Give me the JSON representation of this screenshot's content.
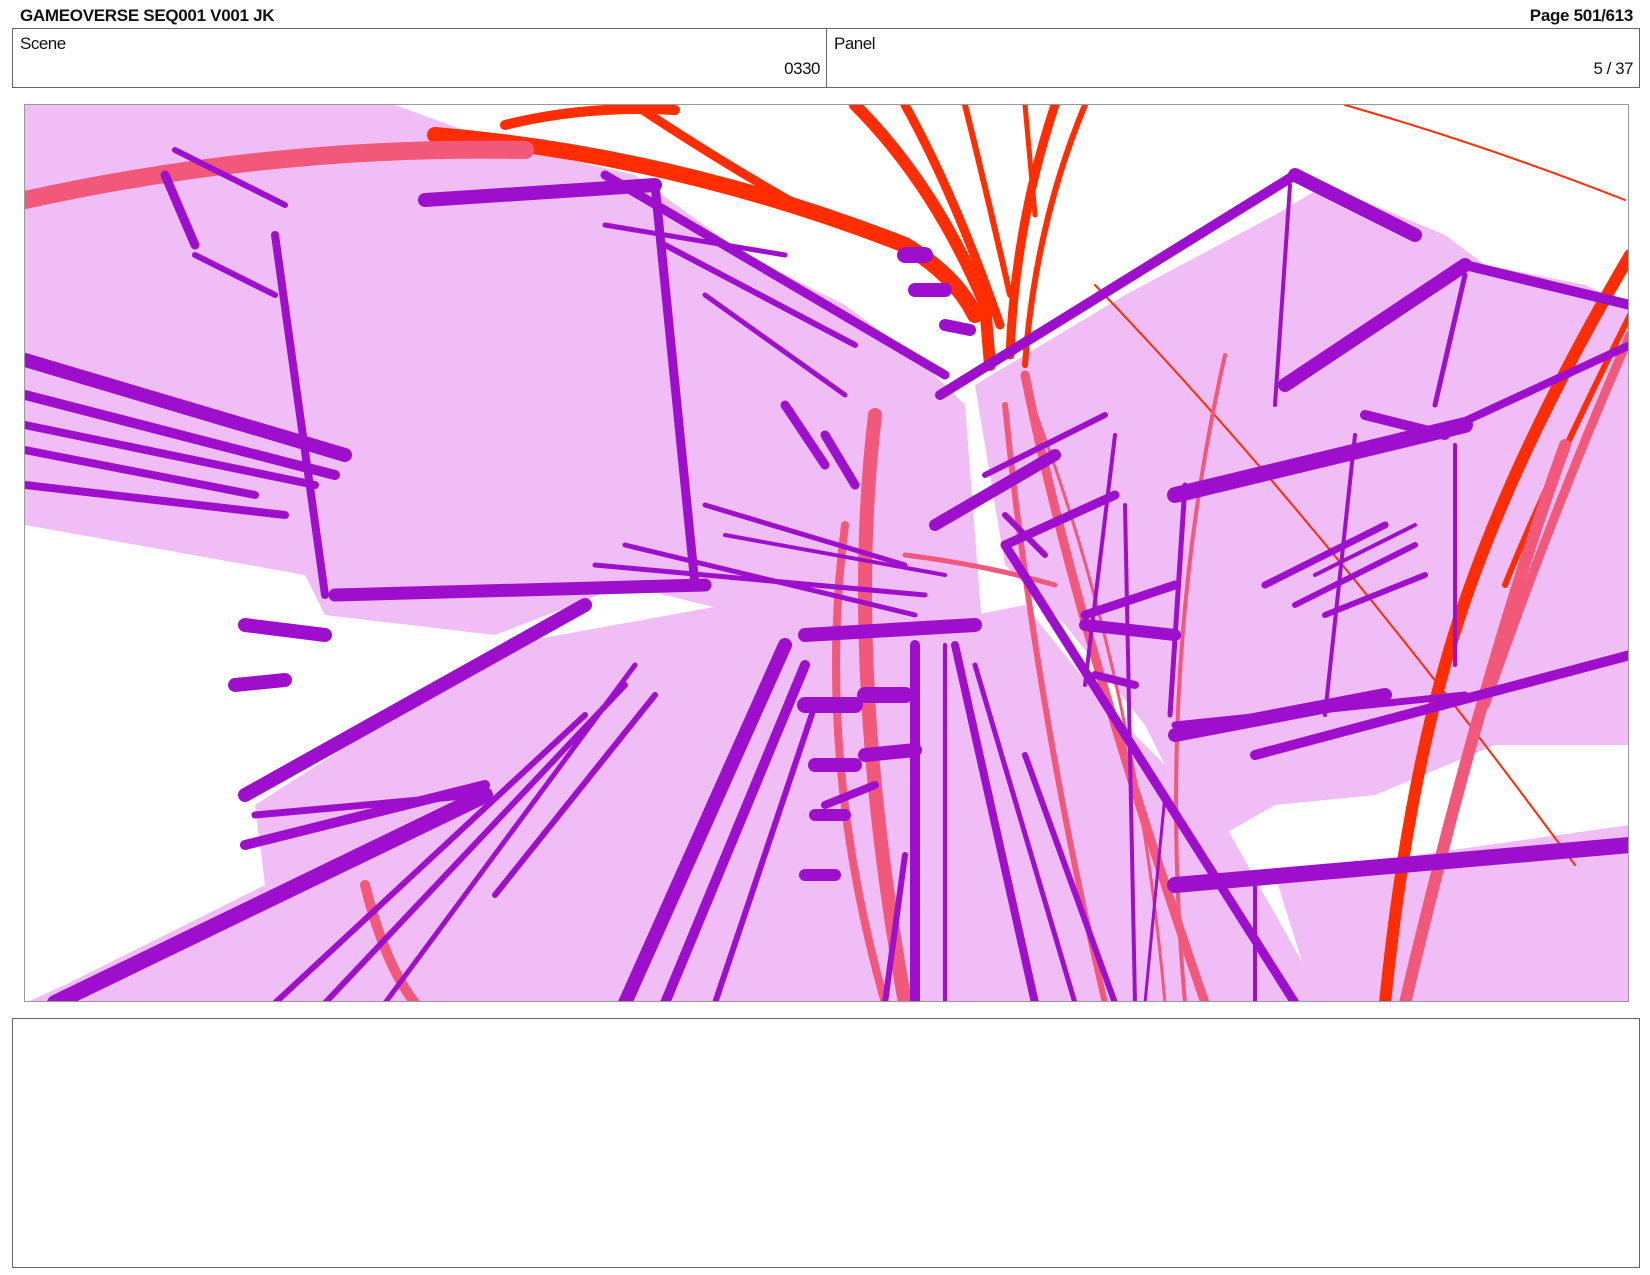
{
  "header": {
    "title": "GAMEOVERSE SEQ001 V001 JK",
    "page": "Page 501/613"
  },
  "info": {
    "scene_label": "Scene",
    "scene_value": "0330",
    "panel_label": "Panel",
    "panel_value": "5 / 37"
  },
  "drawing": {
    "fill_color": "#f0bdf6",
    "stroke_purple": "#9d0fcd",
    "stroke_red": "#ff2d00",
    "stroke_pink": "#f2587a"
  },
  "notes": {
    "text": ""
  }
}
